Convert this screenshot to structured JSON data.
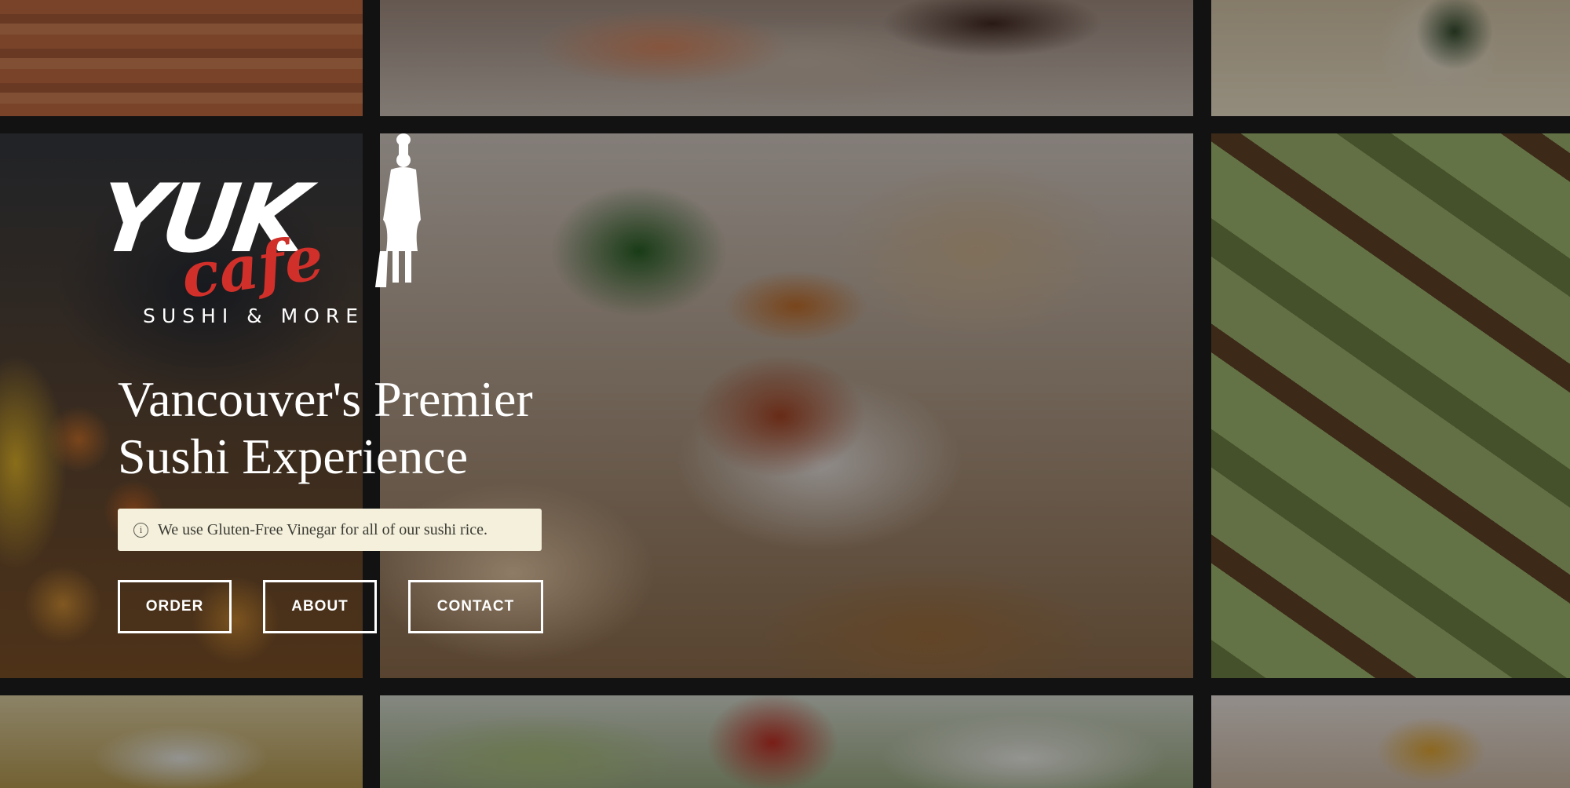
{
  "logo": {
    "wordmark": "YUK",
    "script": "cafe",
    "tagline": "SUSHI & MORE"
  },
  "hero": {
    "title_line1": "Vancouver's Premier",
    "title_line2": "Sushi Experience"
  },
  "notice": {
    "icon": "info-icon",
    "text": "We use Gluten-Free Vinegar for all of our sushi rice."
  },
  "nav": {
    "order_label": "ORDER",
    "about_label": "ABOUT",
    "contact_label": "CONTACT"
  },
  "colors": {
    "accent_red": "#d1302a",
    "notice_bg": "#f4f0dc",
    "page_bg": "#121212"
  }
}
